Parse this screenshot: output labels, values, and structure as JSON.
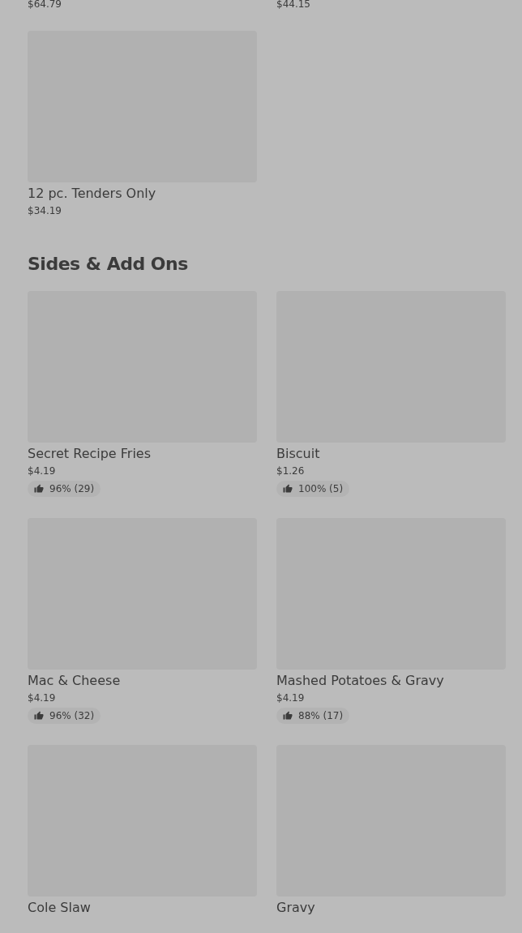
{
  "top_items": [
    {
      "price": "$64.79"
    },
    {
      "price": "$44.15"
    },
    {
      "name": "12 pc. Tenders Only",
      "price": "$34.19"
    }
  ],
  "sections": [
    {
      "title": "Sides & Add Ons",
      "items": [
        {
          "name": "Secret Recipe Fries",
          "price": "$4.19",
          "rating": "96% (29)"
        },
        {
          "name": "Biscuit",
          "price": "$1.26",
          "rating": "100% (5)"
        },
        {
          "name": "Mac & Cheese",
          "price": "$4.19",
          "rating": "96% (32)"
        },
        {
          "name": "Mashed Potatoes & Gravy",
          "price": "$4.19",
          "rating": "88% (17)"
        },
        {
          "name": "Cole Slaw"
        },
        {
          "name": "Gravy"
        }
      ]
    }
  ]
}
